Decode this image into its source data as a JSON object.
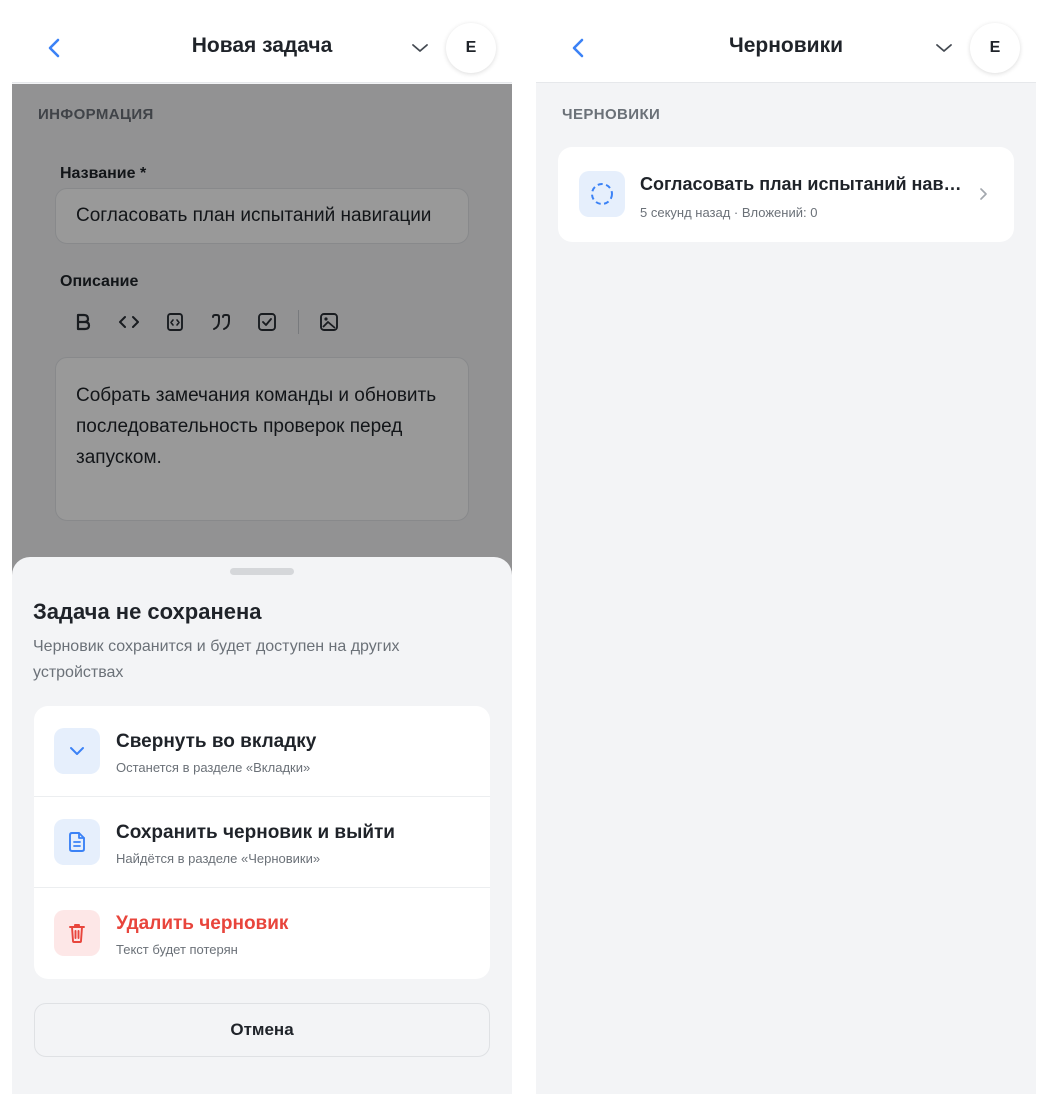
{
  "left_screen": {
    "topbar": {
      "title": "Новая задача",
      "avatar_initial": "Е"
    },
    "section_header": "ИНФОРМАЦИЯ",
    "form": {
      "name_label": "Название *",
      "name_value": "Согласовать план испытаний навигации",
      "description_label": "Описание",
      "description_value": "Собрать замечания команды и обновить последовательность проверок перед запуском.",
      "toolbar_icons": [
        "bold-icon",
        "code-icon",
        "code-block-icon",
        "quote-icon",
        "checkbox-icon",
        "image-icon"
      ]
    },
    "sheet": {
      "title": "Задача не сохранена",
      "subtitle": "Черновик сохранится и будет доступен на других устройствах",
      "options": [
        {
          "title": "Свернуть во вкладку",
          "subtitle": "Останется в разделе «Вкладки»",
          "icon": "chevron-down-icon"
        },
        {
          "title": "Сохранить черновик и выйти",
          "subtitle": "Найдётся в разделе «Черновики»",
          "icon": "document-icon"
        },
        {
          "title": "Удалить черновик",
          "subtitle": "Текст будет потерян",
          "icon": "trash-icon"
        }
      ],
      "cancel_label": "Отмена"
    }
  },
  "right_screen": {
    "topbar": {
      "title": "Черновики",
      "avatar_initial": "Е"
    },
    "section_header": "ЧЕРНОВИКИ",
    "drafts": [
      {
        "title": "Согласовать план испытаний навигации",
        "meta": "5 секунд назад · Вложений: 0",
        "icon": "draft-status-icon"
      }
    ]
  },
  "colors": {
    "accent": "#3b82f6",
    "danger": "#e8453c",
    "background": "#f3f4f6",
    "overlay": "rgba(0,0,0,0.40)"
  }
}
